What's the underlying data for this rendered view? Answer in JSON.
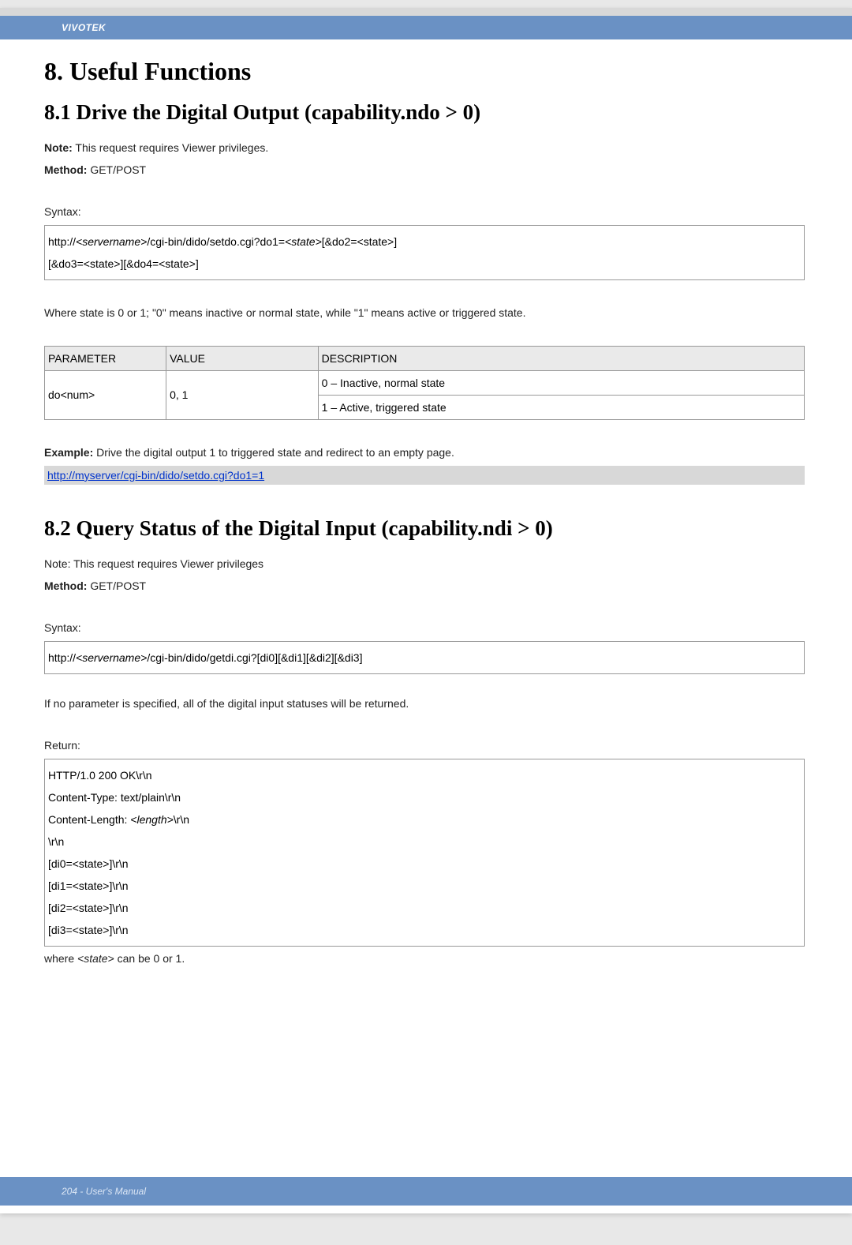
{
  "brand": "VIVOTEK",
  "h1": "8. Useful Functions",
  "section81": {
    "title": "8.1 Drive the Digital Output (capability.ndo > 0)",
    "note_label": "Note:",
    "note_text": " This request requires Viewer privileges.",
    "method_label": "Method:",
    "method_text": " GET/POST",
    "syntax_label": "Syntax:",
    "syntax_line1a": "http://",
    "syntax_line1b": "<servername>",
    "syntax_line1c": "/cgi-bin/dido/setdo.cgi?do1=",
    "syntax_line1d": "<state>",
    "syntax_line1e": "[&do2=<state>]",
    "syntax_line2": "[&do3=<state>][&do4=<state>]",
    "where_text": "Where state is 0 or 1; \"0\" means inactive or normal state, while \"1\" means active or triggered state.",
    "table": {
      "h_param": "PARAMETER",
      "h_value": "VALUE",
      "h_desc": "DESCRIPTION",
      "r1_param": "do<num>",
      "r1_value": "0, 1",
      "r1_desc1": "0 – Inactive, normal state",
      "r1_desc2": "1 – Active, triggered state"
    },
    "example_label": "Example:",
    "example_text": " Drive the digital output 1 to triggered state and redirect to an empty page.",
    "example_link": "http://myserver/cgi-bin/dido/setdo.cgi?do1=1"
  },
  "section82": {
    "title": "8.2 Query Status of the Digital Input (capability.ndi > 0)",
    "note_text": "Note: This request requires Viewer privileges",
    "method_label": "Method:",
    "method_text": " GET/POST",
    "syntax_label": "Syntax:",
    "syntax_line1a": "http://",
    "syntax_line1b": "<servername>",
    "syntax_line1c": "/cgi-bin/dido/getdi.cgi?[di0][&di1][&di2][&di3]",
    "noparam_text": "If no parameter is specified, all of the digital input statuses will be returned.",
    "return_label": "Return:",
    "return_lines": {
      "l1": "HTTP/1.0 200 OK\\r\\n",
      "l2": "Content-Type: text/plain\\r\\n",
      "l3a": "Content-Length: ",
      "l3b": "<length>",
      "l3c": "\\r\\n",
      "l4": "\\r\\n",
      "l5": "[di0=<state>]\\r\\n",
      "l6": "[di1=<state>]\\r\\n",
      "l7": "[di2=<state>]\\r\\n",
      "l8": "[di3=<state>]\\r\\n"
    },
    "where_a": "where ",
    "where_b": "<state>",
    "where_c": " can be 0 or 1."
  },
  "footer": "204 - User's Manual"
}
